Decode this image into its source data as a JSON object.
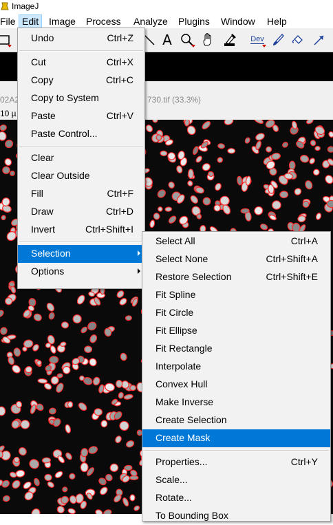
{
  "app": {
    "title": "ImageJ"
  },
  "menubar": [
    "File",
    "Edit",
    "Image",
    "Process",
    "Analyze",
    "Plugins",
    "Window",
    "Help"
  ],
  "menubar_active": "Edit",
  "toolbar": {
    "text_tool_glyph": "A",
    "dev_label": "Dev",
    "icons": [
      "rectangle-tool-icon",
      "angle-tool-icon",
      "text-tool-icon",
      "magnifier-tool-icon",
      "hand-tool-icon",
      "dropper-tool-icon",
      "dev-menu-icon",
      "brush-tool-icon",
      "flood-fill-tool-icon",
      "arrow-tool-icon"
    ],
    "accent_color": "#cc0000"
  },
  "image_window": {
    "title_left": "02A2",
    "title_right": "730.tif (33.3%)",
    "info": "10 µ"
  },
  "edit_menu": {
    "items": [
      {
        "label": "Undo",
        "shortcut": "Ctrl+Z"
      },
      {
        "sep": true
      },
      {
        "label": "Cut",
        "shortcut": "Ctrl+X"
      },
      {
        "label": "Copy",
        "shortcut": "Ctrl+C"
      },
      {
        "label": "Copy to System",
        "shortcut": ""
      },
      {
        "label": "Paste",
        "shortcut": "Ctrl+V"
      },
      {
        "label": "Paste Control...",
        "shortcut": ""
      },
      {
        "sep": true
      },
      {
        "label": "Clear",
        "shortcut": ""
      },
      {
        "label": "Clear Outside",
        "shortcut": ""
      },
      {
        "label": "Fill",
        "shortcut": "Ctrl+F"
      },
      {
        "label": "Draw",
        "shortcut": "Ctrl+D"
      },
      {
        "label": "Invert",
        "shortcut": "Ctrl+Shift+I"
      },
      {
        "sep": true
      },
      {
        "label": "Selection",
        "shortcut": "",
        "submenu": true,
        "selected": true
      },
      {
        "label": "Options",
        "shortcut": "",
        "submenu": true
      }
    ]
  },
  "selection_menu": {
    "items": [
      {
        "label": "Select All",
        "shortcut": "Ctrl+A"
      },
      {
        "label": "Select None",
        "shortcut": "Ctrl+Shift+A"
      },
      {
        "label": "Restore Selection",
        "shortcut": "Ctrl+Shift+E"
      },
      {
        "label": "Fit Spline",
        "shortcut": ""
      },
      {
        "label": "Fit Circle",
        "shortcut": ""
      },
      {
        "label": "Fit Ellipse",
        "shortcut": ""
      },
      {
        "label": "Fit Rectangle",
        "shortcut": ""
      },
      {
        "label": "Interpolate",
        "shortcut": ""
      },
      {
        "label": "Convex Hull",
        "shortcut": ""
      },
      {
        "label": "Make Inverse",
        "shortcut": ""
      },
      {
        "label": "Create Selection",
        "shortcut": ""
      },
      {
        "label": "Create Mask",
        "shortcut": "",
        "selected": true
      },
      {
        "sep": true
      },
      {
        "label": "Properties...",
        "shortcut": "Ctrl+Y"
      },
      {
        "label": "Scale...",
        "shortcut": ""
      },
      {
        "label": "Rotate...",
        "shortcut": ""
      },
      {
        "label": "To Bounding Box",
        "shortcut": ""
      }
    ]
  },
  "colors": {
    "selection_highlight": "#0078d7",
    "roi_outline": "#ff2a2a",
    "menubar_active_bg": "#cce8ff"
  }
}
